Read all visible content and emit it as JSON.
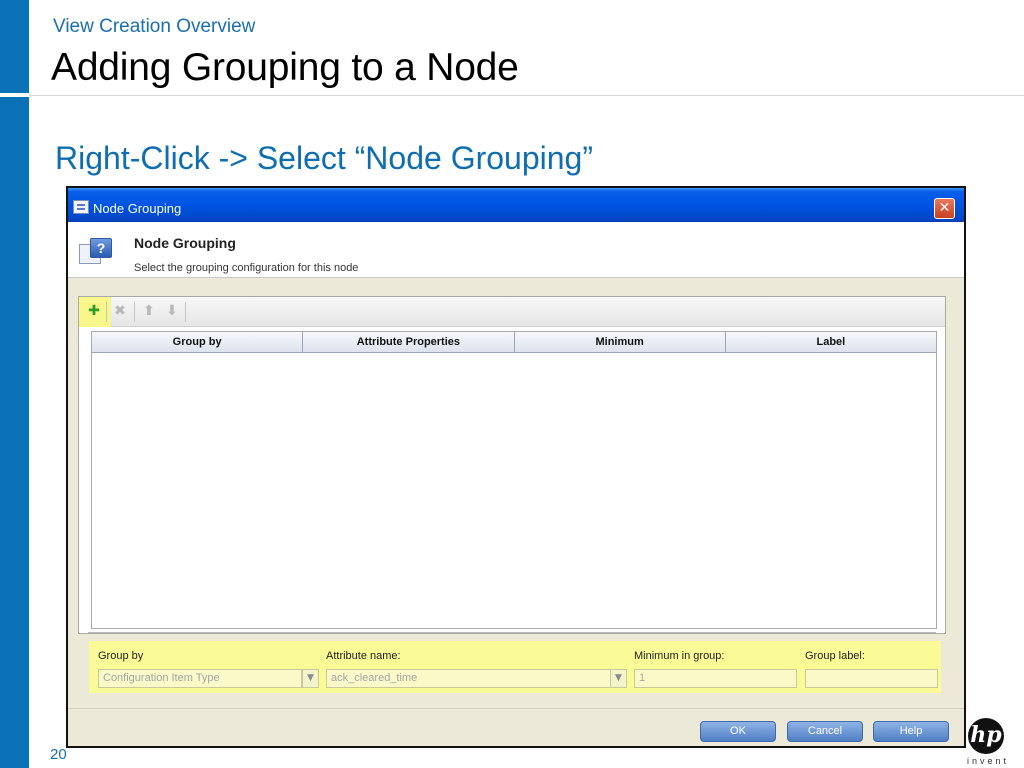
{
  "slide": {
    "section_title": "View Creation Overview",
    "title": "Adding Grouping to a Node",
    "subtitle": "Right-Click -> Select “Node Grouping”",
    "page_number": "20",
    "logo_text": "hp",
    "logo_tagline": "invent"
  },
  "dialog": {
    "window_title": "Node Grouping",
    "close_glyph": "✕",
    "header": {
      "title": "Node Grouping",
      "description": "Select the grouping configuration for this node",
      "icon": "help-icon",
      "icon_glyph": "?"
    },
    "toolbar": {
      "add_icon": "✚",
      "delete_icon": "✖",
      "up_icon": "⬆",
      "down_icon": "⬇"
    },
    "table": {
      "columns": [
        "Group by",
        "Attribute Properties",
        "Minimum",
        "Label"
      ],
      "rows": []
    },
    "form": {
      "group_by_label": "Group by",
      "group_by_value": "Configuration Item Type",
      "attribute_name_label": "Attribute name:",
      "attribute_name_value": "ack_cleared_time",
      "minimum_label": "Minimum in group:",
      "minimum_value": "1",
      "group_label_label": "Group label:",
      "group_label_value": "",
      "dropdown_glyph": "▼"
    },
    "buttons": {
      "ok": "OK",
      "cancel": "Cancel",
      "help": "Help"
    }
  },
  "colors": {
    "slide_accent": "#0b72b8",
    "subtitle": "#0f6db2",
    "titlebar": "#0054e3",
    "highlight": "#fafa96"
  }
}
